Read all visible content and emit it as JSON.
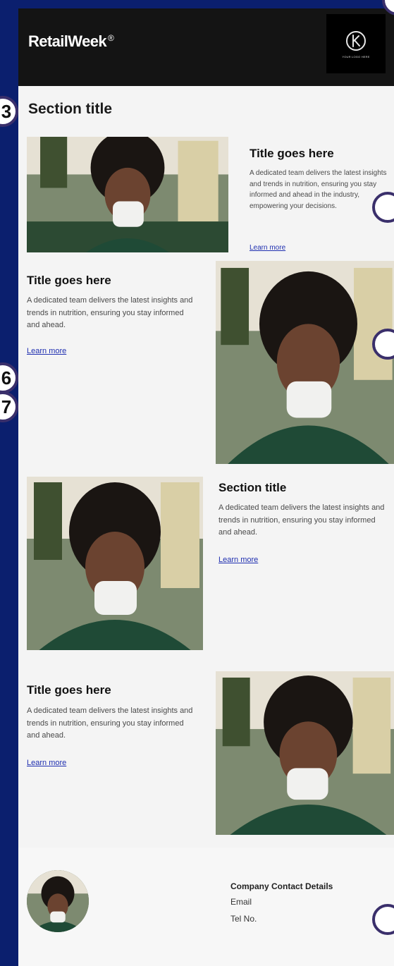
{
  "header": {
    "brand": "RetailWeek",
    "brand_mark": "®",
    "logo_icon": "k-monogram-icon",
    "logo_caption": "YOUR LOGO HERE"
  },
  "section_title": "Section title",
  "blocks": [
    {
      "title": "Title goes here",
      "text": "A dedicated team delivers the latest insights and trends in nutrition, ensuring you stay informed and ahead in the industry, empowering your decisions.",
      "link": "Learn more"
    },
    {
      "title": "Title goes here",
      "text": "A dedicated team delivers the latest insights and trends in nutrition, ensuring you stay informed and ahead.",
      "link": "Learn more"
    },
    {
      "title": "Section title",
      "text": "A dedicated team delivers the latest insights and trends in nutrition, ensuring you stay informed and ahead.",
      "link": "Learn more"
    },
    {
      "title": "Title goes here",
      "text": "A dedicated team delivers the latest insights and trends in nutrition, ensuring you stay informed and ahead.",
      "link": "Learn more"
    }
  ],
  "footer": {
    "contact_title": "Company Contact Details",
    "email": "Email",
    "tel": "Tel No."
  },
  "markers": [
    "3",
    "6",
    "7"
  ],
  "colors": {
    "page_background": "#0b1f6e",
    "header_background": "#141414",
    "content_background": "#f4f4f4",
    "link": "#1f2fb0",
    "marker_border": "#3a2f6b"
  }
}
